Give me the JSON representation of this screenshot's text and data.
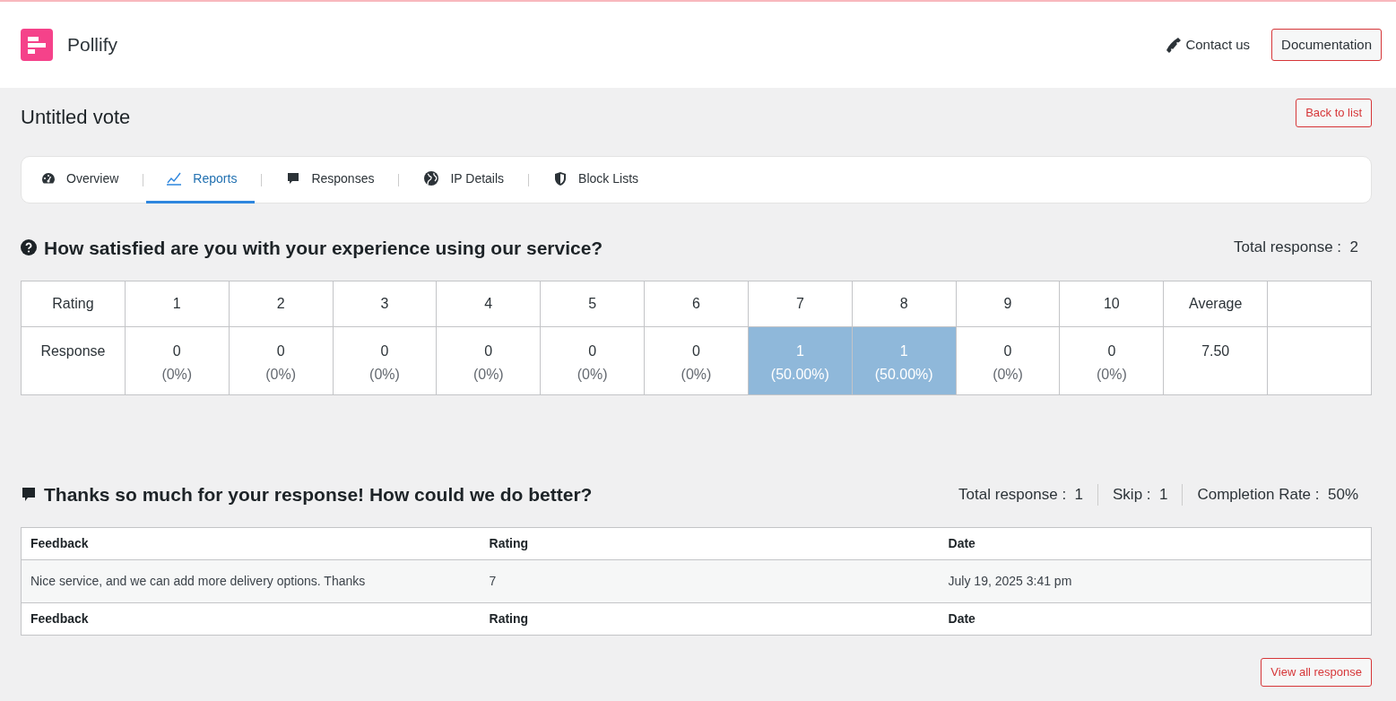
{
  "header": {
    "brand": "Pollify",
    "contact": "Contact us",
    "documentation": "Documentation"
  },
  "page": {
    "title": "Untitled vote",
    "back_button": "Back to list"
  },
  "tabs": [
    {
      "label": "Overview",
      "kind": "gauge",
      "selected": false
    },
    {
      "label": "Reports",
      "kind": "chart",
      "selected": true
    },
    {
      "label": "Responses",
      "kind": "comment",
      "selected": false
    },
    {
      "label": "IP Details",
      "kind": "globe",
      "selected": false
    },
    {
      "label": "Block Lists",
      "kind": "shield",
      "selected": false
    }
  ],
  "rating_question": {
    "title": "How satisfied are you with your experience using our service?",
    "stats": [
      {
        "label": "Total response :",
        "value": "2"
      }
    ],
    "row_labels": [
      "Rating",
      "Response"
    ],
    "columns": [
      {
        "rating": "1",
        "count": "0",
        "percent": "(0%)",
        "highlighted": false
      },
      {
        "rating": "2",
        "count": "0",
        "percent": "(0%)",
        "highlighted": false
      },
      {
        "rating": "3",
        "count": "0",
        "percent": "(0%)",
        "highlighted": false
      },
      {
        "rating": "4",
        "count": "0",
        "percent": "(0%)",
        "highlighted": false
      },
      {
        "rating": "5",
        "count": "0",
        "percent": "(0%)",
        "highlighted": false
      },
      {
        "rating": "6",
        "count": "0",
        "percent": "(0%)",
        "highlighted": false
      },
      {
        "rating": "7",
        "count": "1",
        "percent": "(50.00%)",
        "highlighted": true
      },
      {
        "rating": "8",
        "count": "1",
        "percent": "(50.00%)",
        "highlighted": true
      },
      {
        "rating": "9",
        "count": "0",
        "percent": "(0%)",
        "highlighted": false
      },
      {
        "rating": "10",
        "count": "0",
        "percent": "(0%)",
        "highlighted": false
      }
    ],
    "average": {
      "label": "Average",
      "value": "7.50"
    }
  },
  "feedback_question": {
    "title": "Thanks so much for your response! How could we do better?",
    "stats": [
      {
        "label": "Total response :",
        "value": "1"
      },
      {
        "label": "Skip :",
        "value": "1"
      },
      {
        "label": "Completion Rate :",
        "value": "50%"
      }
    ],
    "columns": [
      "Feedback",
      "Rating",
      "Date"
    ],
    "rows": [
      [
        "Nice service, and we can add more delivery options. Thanks",
        "7",
        "July 19, 2025 3:41 pm"
      ]
    ],
    "footer_columns": [
      "Feedback",
      "Rating",
      "Date"
    ],
    "view_all_button": "View all response"
  }
}
